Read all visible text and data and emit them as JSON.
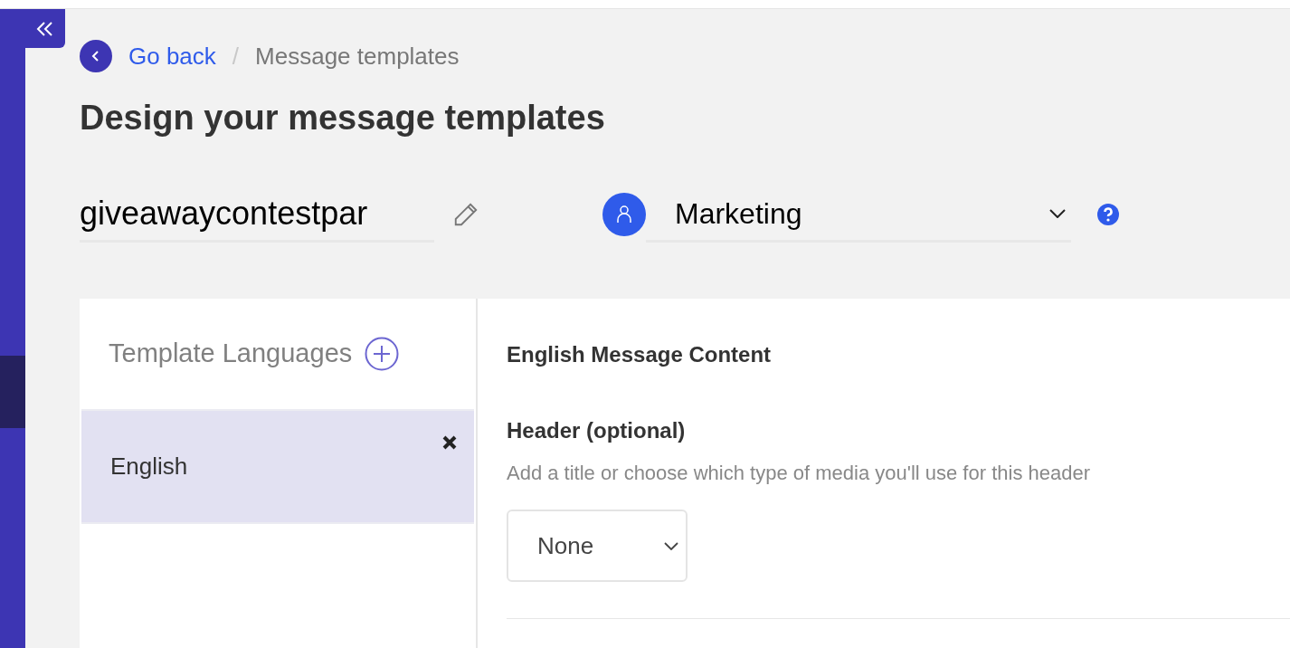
{
  "breadcrumb": {
    "back": "Go back",
    "separator": "/",
    "current": "Message templates"
  },
  "title": "Design your message templates",
  "template_name": {
    "value": "giveawaycontestpar"
  },
  "category": {
    "value": "Marketing"
  },
  "languages": {
    "heading": "Template Languages",
    "items": [
      {
        "label": "English",
        "selected": true
      }
    ]
  },
  "content": {
    "heading": "English Message Content",
    "header_label": "Header (optional)",
    "header_hint": "Add a title or choose which type of media you'll use for this header",
    "header_type": "None"
  }
}
